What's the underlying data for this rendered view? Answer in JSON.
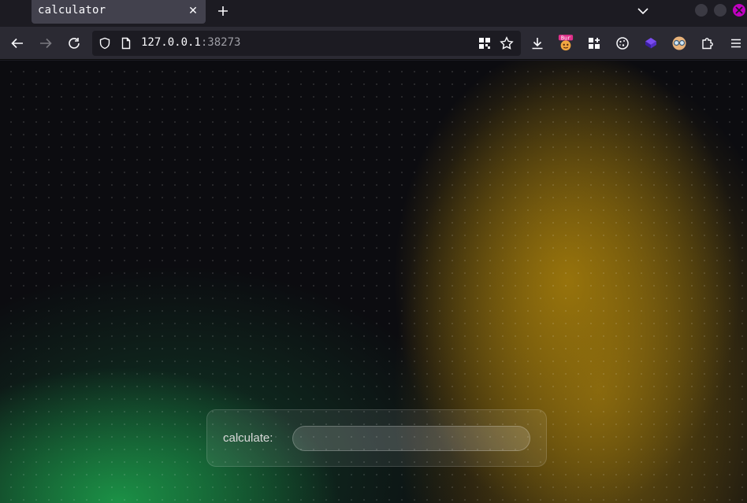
{
  "browser": {
    "tab": {
      "title": "calculator"
    },
    "url": {
      "host": "127.0.0.1",
      "port": ":38273"
    },
    "extensions": [
      {
        "name": "burp-icon",
        "badge": "Bur"
      },
      {
        "name": "grid-addon-icon"
      },
      {
        "name": "cookie-icon"
      },
      {
        "name": "cube-icon"
      },
      {
        "name": "glasses-icon"
      },
      {
        "name": "puzzle-icon"
      }
    ]
  },
  "page": {
    "calculator": {
      "label": "calculate:",
      "value": "",
      "placeholder": ""
    }
  },
  "colors": {
    "accent_yellow": "#9b760c",
    "accent_green": "#1c9648",
    "background": "#0c0c10"
  }
}
